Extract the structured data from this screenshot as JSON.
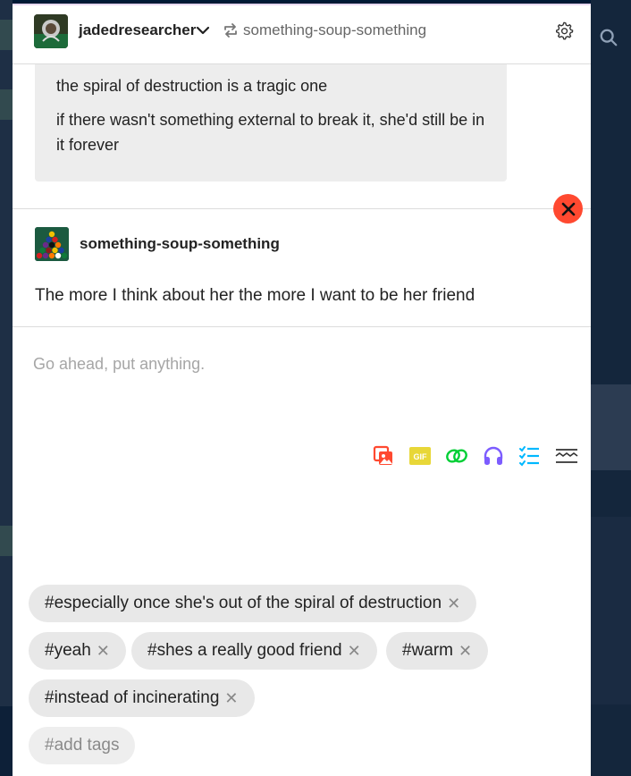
{
  "header": {
    "blog_name": "jadedresearcher",
    "reblog_source": "something-soup-something",
    "icons": [
      "chevron-down-icon",
      "reblog-icon",
      "gear-icon"
    ]
  },
  "quote": {
    "paragraphs": [
      "the spiral of destruction is a tragic one",
      "if there wasn't something external to break it, she'd still be in it forever"
    ]
  },
  "reblog": {
    "author": "something-soup-something",
    "body": "The more I think about her the more I want to be her friend"
  },
  "editor": {
    "placeholder": "Go ahead, put anything."
  },
  "toolbar": {
    "icons": [
      "image-icon",
      "gif-icon",
      "link-icon",
      "audio-icon",
      "checklist-icon",
      "readmore-icon"
    ],
    "gif_label": "GIF"
  },
  "tags": {
    "items": [
      "#especially once she's out of the spiral of destruction",
      "#yeah",
      "#shes a really good friend",
      "#warm",
      "#instead of incinerating"
    ],
    "remove_glyph": "✕",
    "add_placeholder": "#add tags"
  },
  "colors": {
    "close_red": "#ff4930",
    "image_red": "#ff4930",
    "gif_yellow": "#e8d738",
    "link_green": "#00cf35",
    "audio_purple": "#7c5cff",
    "checklist_blue": "#00b8ff"
  }
}
